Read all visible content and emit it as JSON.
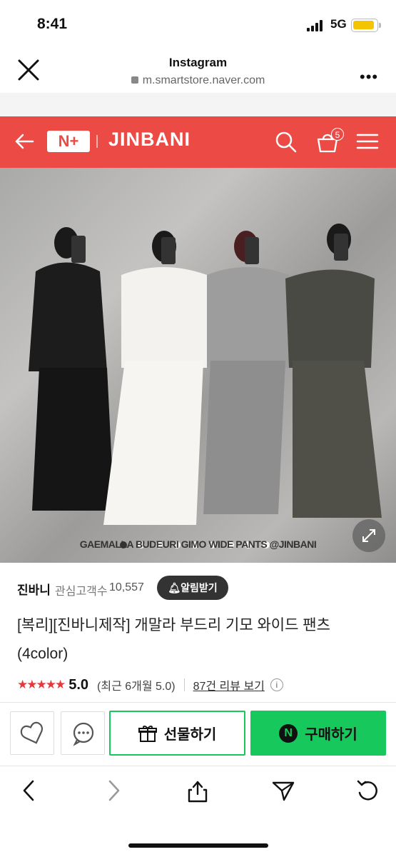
{
  "status_bar": {
    "time": "8:41",
    "network": "5G"
  },
  "browser": {
    "origin": "Instagram",
    "url": "m.smartstore.naver.com"
  },
  "store_header": {
    "nplus_label": "N+",
    "brand": "JINBANI",
    "cart_count": "5",
    "colors": {
      "header": "#ec4b45"
    }
  },
  "hero": {
    "caption": "GAEMALLA BUDEURI GIMO WIDE PANTS @JINBANI",
    "dots_total": 9,
    "dots_active_index": 0
  },
  "seller": {
    "name": "진바니",
    "followers_label": "관심고객수",
    "followers_count": "10,557",
    "notify_label": "알림받기"
  },
  "product": {
    "title": "[복리][진바니제작] 개말라 부드리 기모 와이드 팬츠 (4color)"
  },
  "rating": {
    "stars": "★★★★★",
    "score": "5.0",
    "recent": "(최근 6개월 5.0)",
    "reviews_link": "87건 리뷰 보기"
  },
  "actions": {
    "gift_label": "선물하기",
    "buy_label": "구매하기",
    "n_badge": "N",
    "accent": "#17c85c"
  },
  "toolbar": {
    "items": [
      "back-icon",
      "forward-icon",
      "share-icon",
      "send-icon",
      "reload-icon"
    ]
  }
}
